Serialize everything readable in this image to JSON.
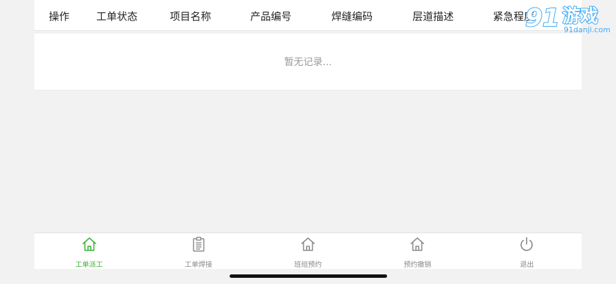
{
  "table": {
    "columns": [
      "操作",
      "工单状态",
      "项目名称",
      "产品编号",
      "焊缝编码",
      "层道描述",
      "紧急程度"
    ],
    "empty_text": "暂无记录..."
  },
  "tabbar": {
    "items": [
      {
        "label": "工单派工",
        "icon": "home-icon",
        "active": true
      },
      {
        "label": "工单焊接",
        "icon": "clipboard-icon",
        "active": false
      },
      {
        "label": "班组预约",
        "icon": "home-icon",
        "active": false
      },
      {
        "label": "预约撤销",
        "icon": "home-icon",
        "active": false
      },
      {
        "label": "退出",
        "icon": "power-icon",
        "active": false
      }
    ]
  },
  "watermark": {
    "brand": "游戏",
    "url": "91danji.com",
    "number": "91"
  },
  "colors": {
    "accent": "#3cb034",
    "icon_inactive": "#8a8a8a",
    "watermark": "#3fa9f5"
  }
}
